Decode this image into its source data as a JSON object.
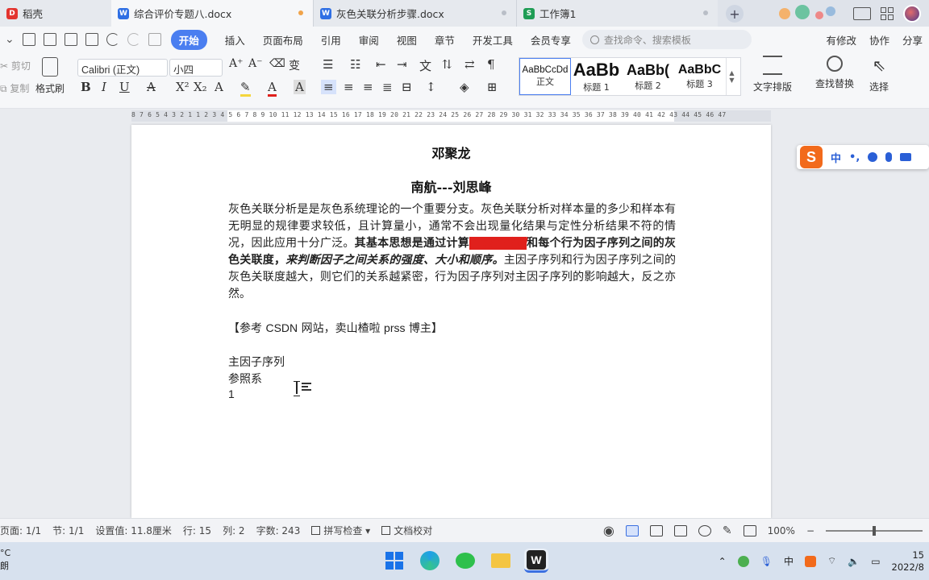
{
  "tabs": [
    {
      "label": "稻壳",
      "icon_color": "#e3342f",
      "icon_glyph": "D"
    },
    {
      "label": "综合评价专题八.docx",
      "icon_color": "#2f6fe4",
      "icon_glyph": "W"
    },
    {
      "label": "灰色关联分析步骤.docx",
      "icon_color": "#2f6fe4",
      "icon_glyph": "W"
    },
    {
      "label": "工作簿1",
      "icon_color": "#1f9d55",
      "icon_glyph": "S"
    }
  ],
  "menu": {
    "start": "开始",
    "items": [
      "插入",
      "页面布局",
      "引用",
      "审阅",
      "视图",
      "章节",
      "开发工具",
      "会员专享"
    ],
    "search_placeholder": "查找命令、搜索模板",
    "right": [
      "有修改",
      "协作",
      "分享"
    ]
  },
  "ribbon": {
    "cut": "剪切",
    "copy": "复制",
    "format_painter": "格式刷",
    "font_name": "Calibri (正文)",
    "font_size": "小四",
    "styles": [
      {
        "sample": "AaBbCcDd",
        "label": "正文"
      },
      {
        "sample": "AaBb",
        "label": "标题 1"
      },
      {
        "sample": "AaBb(",
        "label": "标题 2"
      },
      {
        "sample": "AaBbC",
        "label": "标题 3"
      }
    ],
    "text_layout": "文字排版",
    "find_replace": "查找替换",
    "select": "选择"
  },
  "ruler": "8  7  6  5  4  3  2  1     1  2  3  4  5  6  7  8  9  10 11 12 13 14 15 16 17 18 19 20 21 22 23 24 25 26 27 28 29 30 31 32 33 34 35 36 37 38 39 40 41 42 43 44 45 46 47",
  "document": {
    "title1": "邓聚龙",
    "title2": "南航---刘思峰",
    "para_part1": "灰色关联分析是是灰色系统理论的一个重要分支。灰色关联分析对样本量的多少和样本有无明显的规律要求较低，且计算量小，通常不会出现量化结果与定性分析结果不符的情况，因此应用十分广泛。",
    "para_bold": "其基本思想是通过计算",
    "para_hl": "主因子序列",
    "para_bold2": "和每个行为因子序列之间的灰色关联度，",
    "para_bi": "来判断因子之间关系的强度、大小和顺序。",
    "para_part2": "主因子序列和行为因子序列之间的灰色关联度越大，则它们的关系越紧密，行为因子序列对主因子序列的影响越大，反之亦然。",
    "ref_a": "【参考 ",
    "ref_csdn": "CSDN",
    "ref_b": " 网站，卖山楂啦 ",
    "ref_prss": "prss",
    "ref_c": " 博主】",
    "line1": "主因子序列",
    "line2": "参照系",
    "line3": "1"
  },
  "ime": {
    "lang": "中"
  },
  "status": {
    "page": "页面: 1/1",
    "section": "节: 1/1",
    "position": "设置值: 11.8厘米",
    "row": "行: 15",
    "col": "列: 2",
    "words": "字数: 243",
    "spellcheck": "拼写检查",
    "proofread": "文档校对",
    "zoom": "100%"
  },
  "taskbar": {
    "temp": "°C",
    "weather": "朗",
    "clock_time": "15",
    "clock_date": "2022/8"
  },
  "colors": {
    "accent": "#4a7ef0",
    "highlight": "#e0201c"
  }
}
